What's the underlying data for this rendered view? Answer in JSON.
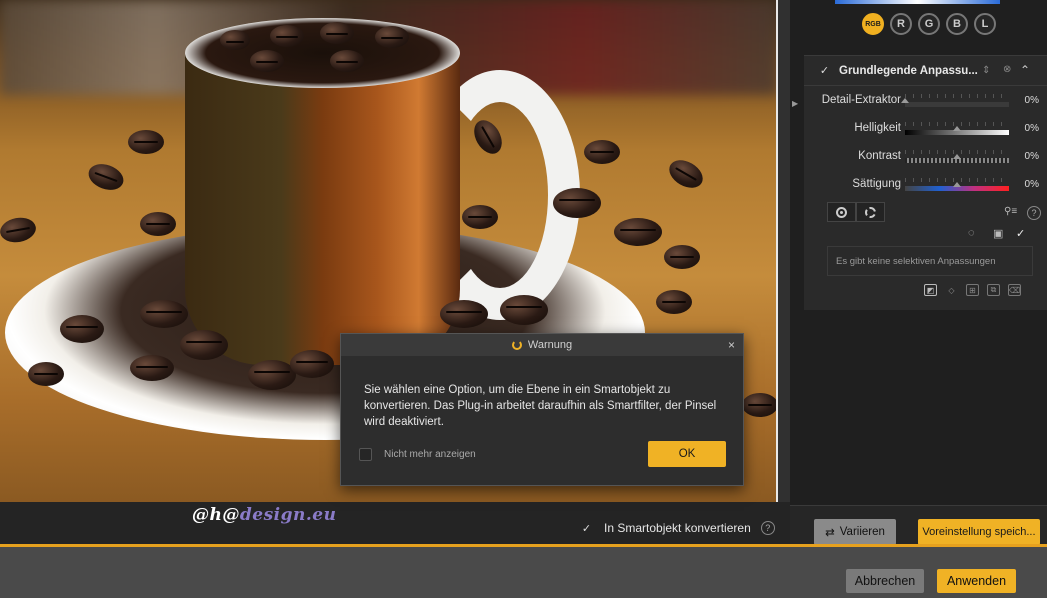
{
  "canvas": {
    "watermark_part1": "@h@",
    "watermark_part2": "design.eu"
  },
  "canvas_bar": {
    "smart_object_label": "In Smartobjekt konvertieren",
    "help_glyph": "?"
  },
  "channels": [
    "RGB",
    "R",
    "G",
    "B",
    "L"
  ],
  "panel": {
    "title": "Grundlegende Anpassu...",
    "sliders": [
      {
        "label": "Detail-Extraktor",
        "value": "0%",
        "level": 0
      },
      {
        "label": "Helligkeit",
        "value": "0%",
        "level": 0.5
      },
      {
        "label": "Kontrast",
        "value": "0%",
        "level": 0.5
      },
      {
        "label": "Sättigung",
        "value": "0%",
        "level": 0.5
      }
    ],
    "help_glyph": "?",
    "selective_empty": "Es gibt keine selektiven Anpassungen"
  },
  "right_bar": {
    "vary_label": "Variieren",
    "preset_label": "Voreinstellung speich..."
  },
  "footer": {
    "cancel_label": "Abbrechen",
    "apply_label": "Anwenden"
  },
  "dialog": {
    "title": "Warnung",
    "close_glyph": "×",
    "message": "Sie wählen eine Option, um die Ebene in ein Smartobjekt zu konvertieren. Das Plug-in arbeitet daraufhin als Smartfilter, der Pinsel wird deaktiviert.",
    "checkbox_label": "Nicht mehr anzeigen",
    "ok_label": "OK"
  },
  "colors": {
    "accent": "#f0b225",
    "panel_bg": "#2a2a2a",
    "footer_bg": "#4a4a4a"
  }
}
